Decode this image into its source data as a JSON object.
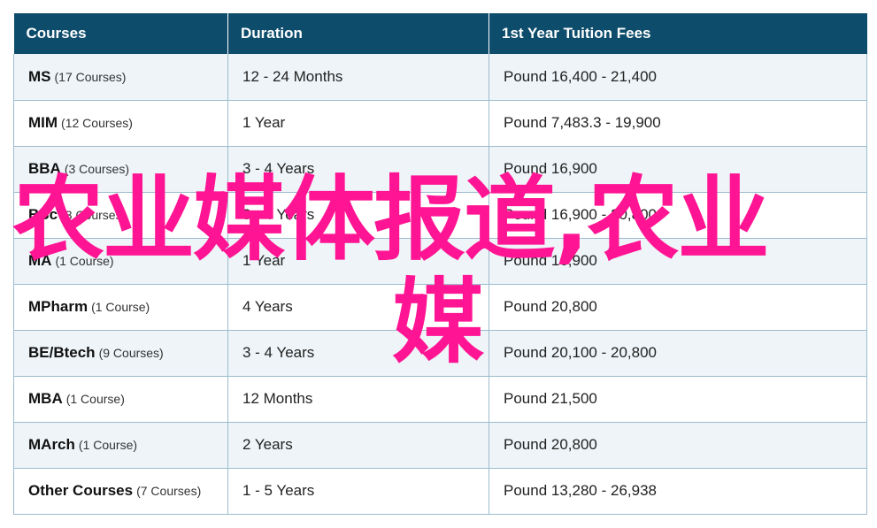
{
  "table": {
    "headers": [
      "Courses",
      "Duration",
      "1st Year Tuition Fees"
    ],
    "rows": [
      {
        "course": "MS",
        "count": "(17 Courses)",
        "duration": "12 - 24 Months",
        "fees": "Pound 16,400 - 21,400"
      },
      {
        "course": "MIM",
        "count": "(12 Courses)",
        "duration": "1 Year",
        "fees": "Pound 7,483.3 - 19,900"
      },
      {
        "course": "BBA",
        "count": "(3 Courses)",
        "duration": "3 - 4 Years",
        "fees": "Pound 16,900"
      },
      {
        "course": "BSc",
        "count": "(3 Courses)",
        "duration": "3 - 4 Years",
        "fees": "Pound 16,900 - 20,800"
      },
      {
        "course": "MA",
        "count": "(1 Course)",
        "duration": "1 Year",
        "fees": "Pound 16,900"
      },
      {
        "course": "MPharm",
        "count": "(1 Course)",
        "duration": "4 Years",
        "fees": "Pound 20,800"
      },
      {
        "course": "BE/Btech",
        "count": "(9 Courses)",
        "duration": "3 - 4 Years",
        "fees": "Pound 20,100 - 20,800"
      },
      {
        "course": "MBA",
        "count": "(1 Course)",
        "duration": "12 Months",
        "fees": "Pound 21,500"
      },
      {
        "course": "MArch",
        "count": "(1 Course)",
        "duration": "2 Years",
        "fees": "Pound 20,800"
      },
      {
        "course": "Other Courses",
        "count": "(7 Courses)",
        "duration": "1 - 5 Years",
        "fees": "Pound 13,280 - 26,938"
      }
    ]
  },
  "overlay": {
    "line1": "农业媒体报道,农业",
    "line2": "媒",
    "color": "#ff1493"
  },
  "colors": {
    "header_bg": "#0e4c6b",
    "row_alt_bg": "#eef4f8",
    "border": "#9bbccd"
  }
}
